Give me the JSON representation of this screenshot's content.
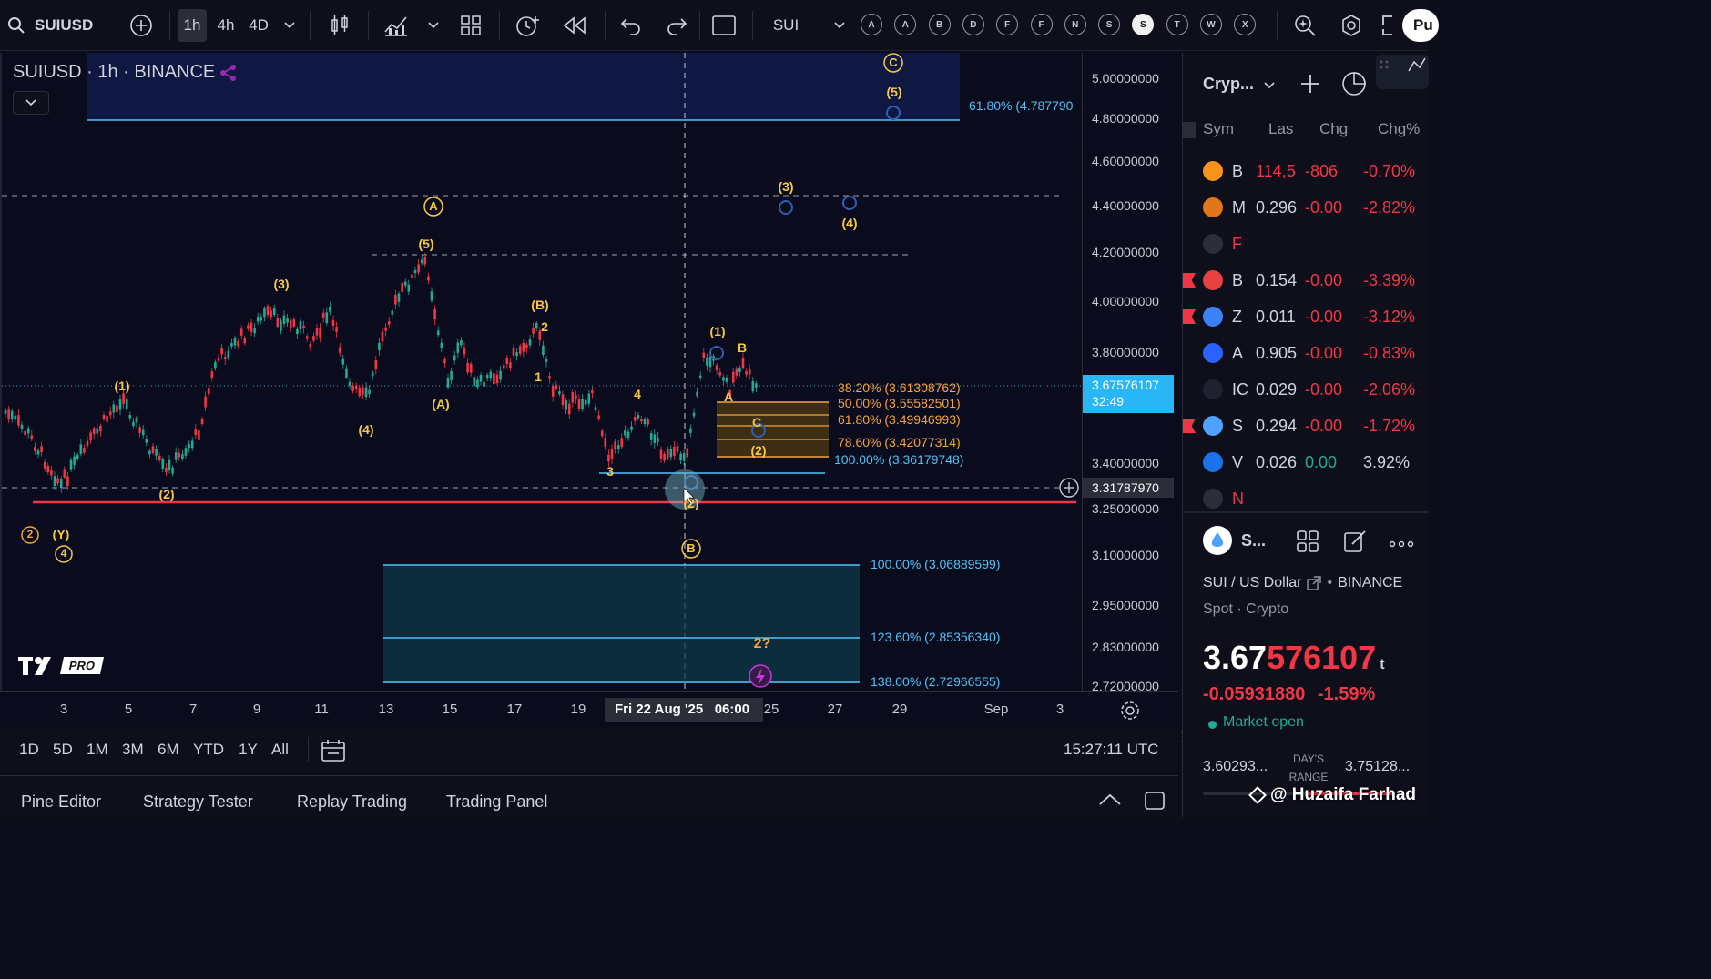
{
  "toolbar": {
    "symbol": "SUIUSD",
    "intervals": [
      "1h",
      "4h",
      "4D"
    ],
    "active_interval": "1h",
    "compare_label": "SUI",
    "letter_buttons": [
      "A",
      "A",
      "B",
      "D",
      "F",
      "F",
      "N",
      "S",
      "S",
      "T",
      "W",
      "X"
    ],
    "active_letter_index": 8,
    "publish_label": "Pu"
  },
  "legend": {
    "title": "SUIUSD · 1h · BINANCE"
  },
  "price_axis": {
    "labels": [
      "5.00000000",
      "4.80000000",
      "4.60000000",
      "4.40000000",
      "4.20000000",
      "4.00000000",
      "3.80000000",
      "3.40000000",
      "3.25000000",
      "3.10000000",
      "2.95000000",
      "2.83000000",
      "2.72000000"
    ],
    "last_price": "3.67576107",
    "countdown": "32:49",
    "crosshair_price": "3.31787970"
  },
  "time_axis": {
    "labels": [
      "3",
      "5",
      "7",
      "9",
      "11",
      "13",
      "15",
      "17",
      "19",
      "25",
      "27",
      "29",
      "Sep",
      "3"
    ],
    "crosshair_label": "Fri 22 Aug '25   06:00"
  },
  "fib_labels": {
    "top": "61.80% (4.787790",
    "upper": [
      "38.20% (3.61308762)",
      "50.00% (3.55582501)",
      "61.80% (3.49946993)",
      "78.60% (3.42077314)",
      "100.00% (3.36179748)"
    ],
    "lower": [
      "100.00% (3.06889599)",
      "123.60% (2.85356340)",
      "138.00% (2.72966555)"
    ]
  },
  "wave_labels": {
    "major": [
      "A",
      "B",
      "C"
    ],
    "minor": [
      "(1)",
      "(2)",
      "(3)",
      "(4)",
      "(5)",
      "(A)",
      "(B)",
      "(Y)",
      "1",
      "2",
      "3",
      "4",
      "A",
      "B",
      "C",
      "2?"
    ],
    "circled_numbers": [
      "2",
      "4"
    ]
  },
  "range_bar": {
    "ranges": [
      "1D",
      "5D",
      "1M",
      "3M",
      "6M",
      "YTD",
      "1Y",
      "All"
    ],
    "clock": "15:27:11 UTC"
  },
  "bottom_tabs": [
    "Pine Editor",
    "Strategy Tester",
    "Replay Trading",
    "Trading Panel"
  ],
  "watchlist": {
    "title": "Cryp...",
    "columns": [
      "Sym",
      "Las",
      "Chg",
      "Chg%"
    ],
    "rows": [
      {
        "sym": "B",
        "last": "114,5",
        "chg": "-806",
        "chgp": "-0.70%",
        "icon_color": "#f7931a",
        "dir": "down"
      },
      {
        "sym": "M",
        "last": "0.296",
        "chg": "-0.00",
        "chgp": "-2.82%",
        "icon_color": "#e2761b",
        "dir": "down"
      },
      {
        "sym": "F",
        "last": "",
        "chg": "",
        "chgp": "",
        "icon_color": "#2a2e39",
        "dir": "down"
      },
      {
        "sym": "B",
        "last": "0.154",
        "chg": "-0.00",
        "chgp": "-3.39%",
        "icon_color": "#e84142",
        "dir": "down"
      },
      {
        "sym": "Z",
        "last": "0.011",
        "chg": "-0.00",
        "chgp": "-3.12%",
        "icon_color": "#3b82f6",
        "dir": "down"
      },
      {
        "sym": "A",
        "last": "0.905",
        "chg": "-0.00",
        "chgp": "-0.83%",
        "icon_color": "#2962ff",
        "dir": "down"
      },
      {
        "sym": "IC",
        "last": "0.029",
        "chg": "-0.00",
        "chgp": "-2.06%",
        "icon_color": "#1e2230",
        "dir": "down"
      },
      {
        "sym": "S",
        "last": "0.294",
        "chg": "-0.00",
        "chgp": "-1.72%",
        "icon_color": "#4da2ff",
        "dir": "down"
      },
      {
        "sym": "V",
        "last": "0.026",
        "chg": "0.00",
        "chgp": "3.92%",
        "icon_color": "#1a73e8",
        "dir": "up"
      },
      {
        "sym": "N",
        "last": "",
        "chg": "",
        "chgp": "",
        "icon_color": "#2a2e39",
        "dir": "down"
      }
    ]
  },
  "details": {
    "short_name": "S...",
    "pair": "SUI / US Dollar",
    "exchange": "BINANCE",
    "type": "Spot · Crypto",
    "price_main": "3.67",
    "price_tail": "576107",
    "currency_suffix": "t",
    "change": "-0.05931880",
    "change_pct": "-1.59%",
    "market_status": "Market open",
    "day_low": "3.60293...",
    "day_range_label": "DAY'S RANGE",
    "day_high": "3.75128..."
  },
  "watermark": "@ Huzaifa Farhad",
  "logo_badge": "PRO",
  "colors": {
    "up": "#22ab94",
    "down": "#f23645",
    "wave": "#f7c843",
    "fib": "#4fc3f7",
    "accent": "#2962ff"
  }
}
